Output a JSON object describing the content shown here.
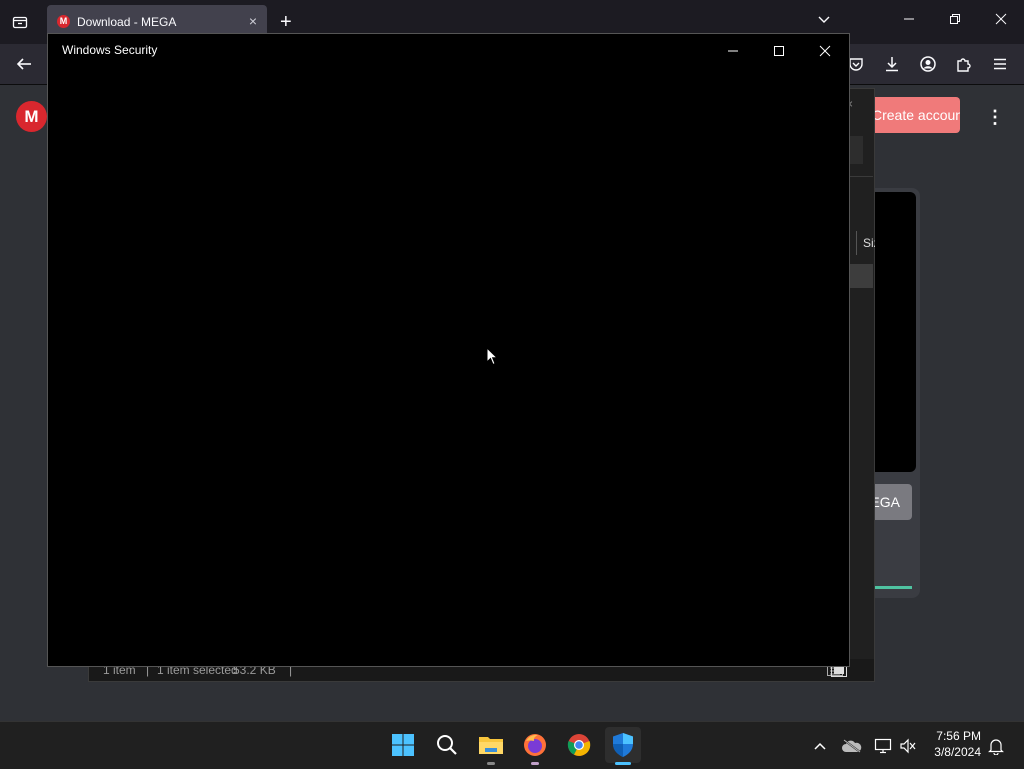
{
  "browser": {
    "tab": {
      "favicon_text": "M",
      "title": "Download - MEGA",
      "close_glyph": "×"
    },
    "new_tab_glyph": "+"
  },
  "page": {
    "logo_text": "M",
    "create_account_label": "Create account",
    "mega_button_label": "MEGA",
    "kebab_glyph": "⋮"
  },
  "explorer": {
    "close_glyph": "×",
    "column_size_label": "Size",
    "status": {
      "items": "1 item",
      "selected": "1 item selected",
      "size": "53.2 KB"
    }
  },
  "dialog": {
    "title": "Windows Security"
  },
  "taskbar": {
    "apps": [
      "start-icon",
      "search-icon",
      "file-explorer-icon",
      "firefox-icon",
      "chrome-icon",
      "windows-security-icon"
    ],
    "tray": [
      "chevron-up-icon",
      "onedrive-icon",
      "network-icon",
      "volume-muted-icon",
      "notification-icon"
    ],
    "time": "7:56 PM",
    "date": "3/8/2024"
  },
  "colors": {
    "accent": "#4cc2ff",
    "mega_red": "#d9272e",
    "create_button": "#f07a7a"
  }
}
